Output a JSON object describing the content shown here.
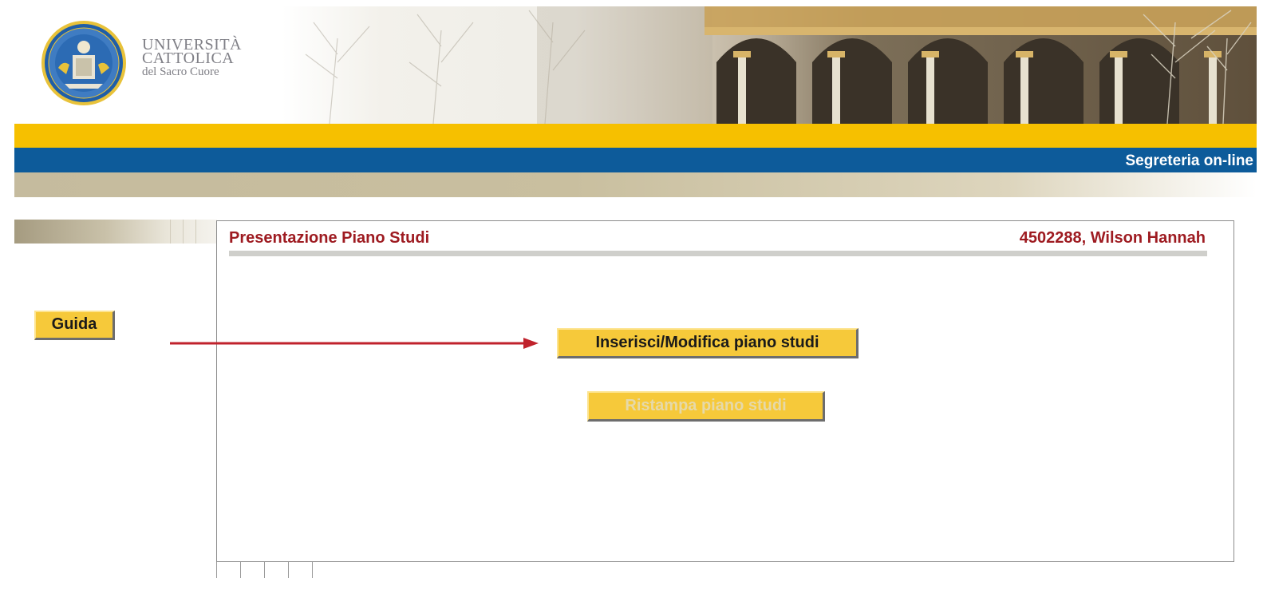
{
  "header": {
    "logo": {
      "line1": "UNIVERSITÀ",
      "line2": "CATTOLICA",
      "line3": "del Sacro Cuore"
    },
    "section_title": "Segreteria on-line",
    "colors": {
      "yellow_band": "#f6c000",
      "blue_band": "#0d5b9a",
      "tan_band": "#c5bb9e"
    }
  },
  "sidebar": {
    "guida_label": "Guida"
  },
  "panel": {
    "title": "Presentazione Piano Studi",
    "user": "4502288, Wilson  Hannah",
    "title_color": "#9e1b21",
    "buttons": {
      "inserisci_label": "Inserisci/Modifica piano studi",
      "ristampa_label": "Ristampa piano studi",
      "ristampa_disabled": true
    }
  },
  "annotation": {
    "arrow_color": "#c0222c"
  }
}
